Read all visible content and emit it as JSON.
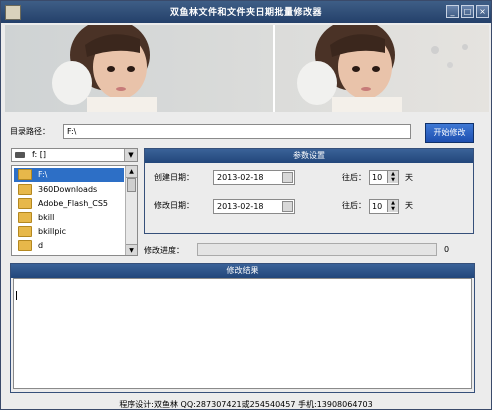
{
  "window": {
    "title": "双鱼林文件和文件夹日期批量修改器",
    "controls": [
      "minimize",
      "maximize",
      "close"
    ]
  },
  "banner": {
    "description_icon": "photo-banner"
  },
  "path": {
    "label": "目录路径：",
    "value": "F:\\",
    "start_button": "开始修改"
  },
  "drive": {
    "selected": "f: []"
  },
  "folders": [
    {
      "name": "F:\\",
      "selected": true
    },
    {
      "name": "360Downloads"
    },
    {
      "name": "Adobe_Flash_CS5"
    },
    {
      "name": "bkill"
    },
    {
      "name": "bkillpic"
    },
    {
      "name": "d"
    }
  ],
  "params": {
    "header": "参数设置",
    "create_label": "创建日期：",
    "create_date": "2013-02-18",
    "modify_label": "修改日期：",
    "modify_date": "2013-02-18",
    "later_label": "往后：",
    "create_offset": "10",
    "modify_offset": "10",
    "unit": "天"
  },
  "progress": {
    "label": "修改进度：",
    "value": "0",
    "fraction": 0
  },
  "result": {
    "header": "修改结果",
    "text": ""
  },
  "footer": {
    "text": "程序设计:双鱼林 QQ:287307421或254540457 手机:13908064703"
  },
  "colors": {
    "titlebar": "#2f4f7a",
    "accent": "#2d6fc6",
    "group_header": "#2d5489"
  }
}
